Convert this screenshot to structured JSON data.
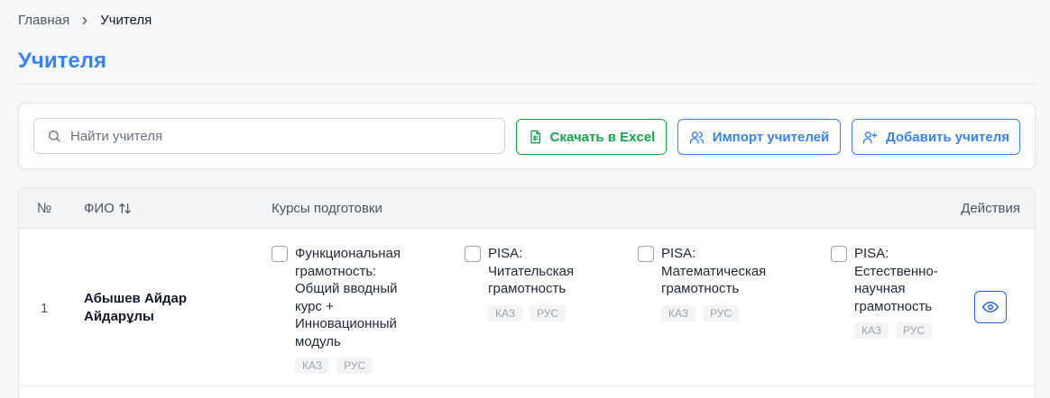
{
  "breadcrumb": {
    "home": "Главная",
    "current": "Учителя"
  },
  "page_title": "Учителя",
  "toolbar": {
    "search_placeholder": "Найти учителя",
    "excel_label": "Скачать в Excel",
    "import_label": "Импорт учителей",
    "add_label": "Добавить учителя"
  },
  "table": {
    "columns": {
      "num": "№",
      "name": "ФИО",
      "courses": "Курсы подготовки",
      "actions": "Действия"
    },
    "rows": [
      {
        "num": "1",
        "name": "Абышев Айдар Айдарұлы",
        "courses": [
          {
            "title": "Функциональная грамотность: Общий вводный курс + Инновационный модуль",
            "tags": [
              "КАЗ",
              "РУС"
            ]
          },
          {
            "title": "PISA: Читательская грамотность",
            "tags": [
              "КАЗ",
              "РУС"
            ]
          },
          {
            "title": "PISA: Математическая грамотность",
            "tags": [
              "КАЗ",
              "РУС"
            ]
          },
          {
            "title": "PISA: Естественно-научная грамотность",
            "tags": [
              "КАЗ",
              "РУС"
            ]
          }
        ]
      }
    ]
  },
  "colors": {
    "accent": "#3b82f6",
    "excel": "#16a34a"
  },
  "icons": [
    "chevron-right-icon",
    "search-icon",
    "spreadsheet-icon",
    "users-icon",
    "user-plus-icon",
    "sort-icon",
    "eye-icon"
  ]
}
